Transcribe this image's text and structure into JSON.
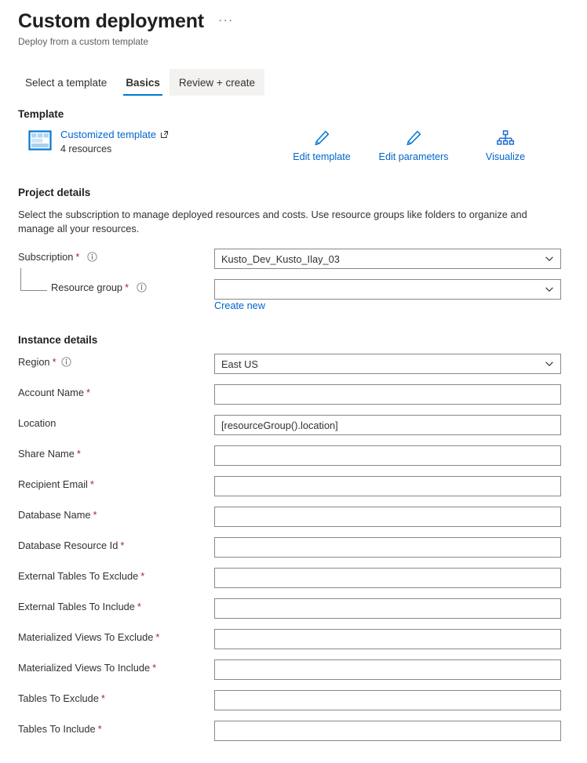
{
  "header": {
    "title": "Custom deployment",
    "subtitle": "Deploy from a custom template",
    "more_label": "···"
  },
  "tabs": [
    {
      "label": "Select a template",
      "state": "normal"
    },
    {
      "label": "Basics",
      "state": "active"
    },
    {
      "label": "Review + create",
      "state": "hovered"
    }
  ],
  "template_section": {
    "heading": "Template",
    "link_label": "Customized template",
    "resource_count": "4 resources",
    "actions": [
      {
        "label": "Edit template",
        "icon": "pencil-icon"
      },
      {
        "label": "Edit parameters",
        "icon": "pencil-icon"
      },
      {
        "label": "Visualize",
        "icon": "hierarchy-icon"
      }
    ]
  },
  "project_details": {
    "heading": "Project details",
    "description": "Select the subscription to manage deployed resources and costs. Use resource groups like folders to organize and manage all your resources.",
    "subscription": {
      "label": "Subscription",
      "required": "*",
      "value": "Kusto_Dev_Kusto_Ilay_03"
    },
    "resource_group": {
      "label": "Resource group",
      "required": "*",
      "value": "",
      "create_new_label": "Create new"
    }
  },
  "instance_details": {
    "heading": "Instance details",
    "fields": [
      {
        "label": "Region",
        "required": "*",
        "value": "East US",
        "type": "select",
        "info": true
      },
      {
        "label": "Account Name",
        "required": "*",
        "value": "",
        "type": "text",
        "info": false
      },
      {
        "label": "Location",
        "required": "",
        "value": "[resourceGroup().location]",
        "type": "text",
        "info": false
      },
      {
        "label": "Share Name",
        "required": "*",
        "value": "",
        "type": "text",
        "info": false
      },
      {
        "label": "Recipient Email",
        "required": "*",
        "value": "",
        "type": "text",
        "info": false
      },
      {
        "label": "Database Name",
        "required": "*",
        "value": "",
        "type": "text",
        "info": false
      },
      {
        "label": "Database Resource Id",
        "required": "*",
        "value": "",
        "type": "text",
        "info": false
      },
      {
        "label": "External Tables To Exclude",
        "required": "*",
        "value": "",
        "type": "text",
        "info": false
      },
      {
        "label": "External Tables To Include",
        "required": "*",
        "value": "",
        "type": "text",
        "info": false
      },
      {
        "label": "Materialized Views To Exclude",
        "required": "*",
        "value": "",
        "type": "text",
        "info": false
      },
      {
        "label": "Materialized Views To Include",
        "required": "*",
        "value": "",
        "type": "text",
        "info": false
      },
      {
        "label": "Tables To Exclude",
        "required": "*",
        "value": "",
        "type": "text",
        "info": false
      },
      {
        "label": "Tables To Include",
        "required": "*",
        "value": "",
        "type": "text",
        "info": false
      }
    ]
  },
  "colors": {
    "accent": "#0078d4",
    "link": "#0066cc",
    "required": "#a4262c",
    "border": "#8a8886",
    "text": "#323130",
    "hover_bg": "#f3f2f1"
  }
}
